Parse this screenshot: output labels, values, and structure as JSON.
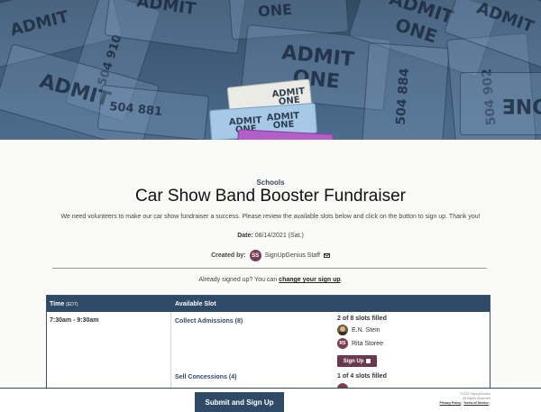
{
  "banner": {
    "ticket_word1": "ADMIT",
    "ticket_word2": "ONE",
    "ticket_numbers": [
      "504 910",
      "504 884",
      "504 902",
      "504 881"
    ]
  },
  "category": "Schools",
  "title": "Car Show Band Booster Fundraiser",
  "description": "We need volunteers to make our car show fundraiser a success. Please review the available slots below and click on the button to sign up. Thank you!",
  "date": {
    "label": "Date:",
    "value": "08/14/2021 (Sat.)"
  },
  "creator": {
    "label": "Created by:",
    "initials": "SS",
    "name": "SignUpGenius Staff"
  },
  "already_signed": {
    "text": "Already signed up? You can",
    "link": "change your sign up",
    "end": "."
  },
  "table": {
    "col_time": "Time",
    "col_time_tz": "(EDT)",
    "col_slot": "Available Slot",
    "time": "7:30am - 9:30am",
    "slots": [
      {
        "name": "Collect Admissions (8)",
        "filled": "2 of 8 slots filled",
        "people": [
          {
            "initials": "",
            "name": "E.N. Stein",
            "color": "#6a5a3a"
          },
          {
            "initials": "RS",
            "name": "Rita Storee",
            "color": "#7a3e52"
          }
        ],
        "button": "Sign Up"
      },
      {
        "name": "Sell Concessions (4)",
        "filled": "1 of 4 slots filled"
      }
    ]
  },
  "footer": {
    "submit": "Submit and Sign Up",
    "copyright": "©2022 SignUpGenius",
    "rights": "All Rights Reserved",
    "privacy": "Privacy Policy",
    "sep": "|",
    "terms": "Terms of Service",
    "end": "|"
  },
  "colors": {
    "navy": "#2f4a66",
    "plum": "#6b3850"
  }
}
